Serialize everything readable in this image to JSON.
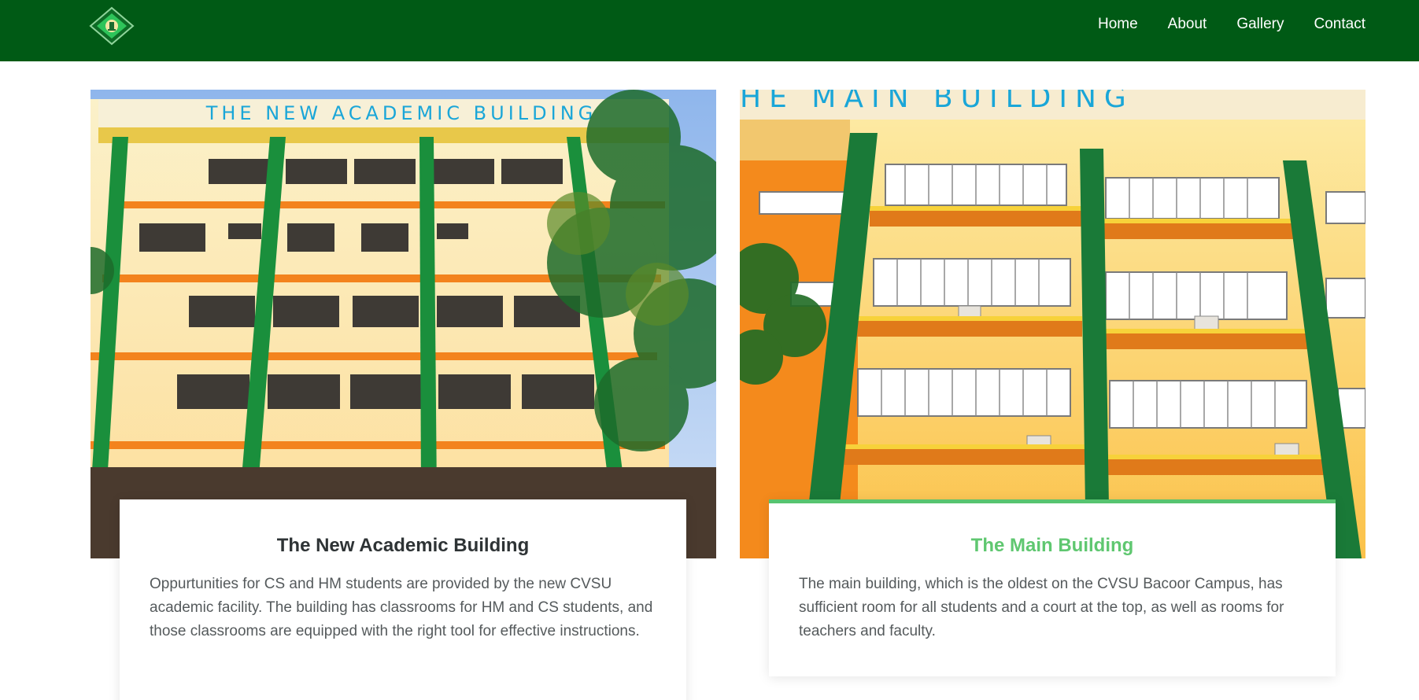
{
  "nav": {
    "logo_icon": "cvsu-seal-icon",
    "links": [
      "Home",
      "About",
      "Gallery",
      "Contact"
    ]
  },
  "colors": {
    "navbar": "#005a15",
    "card_title_active": "#5fc770",
    "card_accent": "#57c470"
  },
  "buildings": [
    {
      "sign": "THE NEW ACADEMIC BUILDING",
      "title": "The New Academic Building",
      "description": "Oppurtunities for CS and HM students are provided by the new CVSU academic facility. The building has classrooms for HM and CS students, and those classrooms are equipped with the right tool for effective instructions."
    },
    {
      "sign": "HE MAIN BUILDING",
      "title": "The Main Building",
      "description": "The main building, which is the oldest on the CVSU Bacoor Campus, has sufficient room for all students and a court at the top, as well as rooms for teachers and faculty."
    }
  ]
}
